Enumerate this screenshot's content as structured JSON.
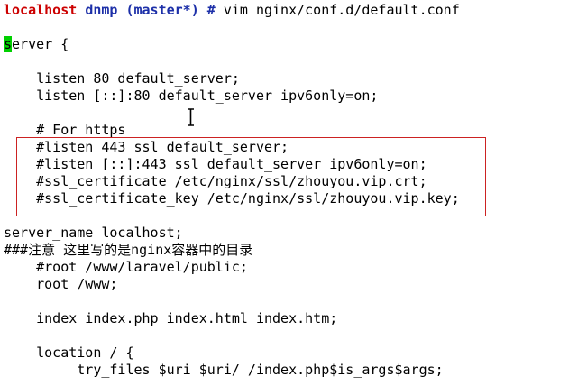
{
  "prompt": {
    "host": "localhost",
    "dir": "dnmp",
    "branch": "(master*)",
    "symbol": "#",
    "command": "vim nginx/conf.d/default.conf"
  },
  "editor": {
    "cursor_char": "s",
    "lines": [
      "erver {",
      "",
      "    listen 80 default_server;",
      "    listen [::]:80 default_server ipv6only=on;",
      "",
      "    # For https",
      "    #listen 443 ssl default_server;",
      "    #listen [::]:443 ssl default_server ipv6only=on;",
      "    #ssl_certificate /etc/nginx/ssl/zhouyou.vip.crt;",
      "    #ssl_certificate_key /etc/nginx/ssl/zhouyou.vip.key;",
      "",
      "server_name localhost;",
      "###注意 这里写的是nginx容器中的目录",
      "    #root /www/laravel/public;",
      "    root /www;",
      "",
      "    index index.php index.html index.htm;",
      "",
      "    location / {",
      "         try_files $uri $uri/ /index.php$is_args$args;"
    ]
  },
  "colors": {
    "prompt_host": "#cc0000",
    "prompt_path": "#1c2fa8",
    "cursor_bg": "#00d000",
    "highlight_border": "#cc2222"
  }
}
